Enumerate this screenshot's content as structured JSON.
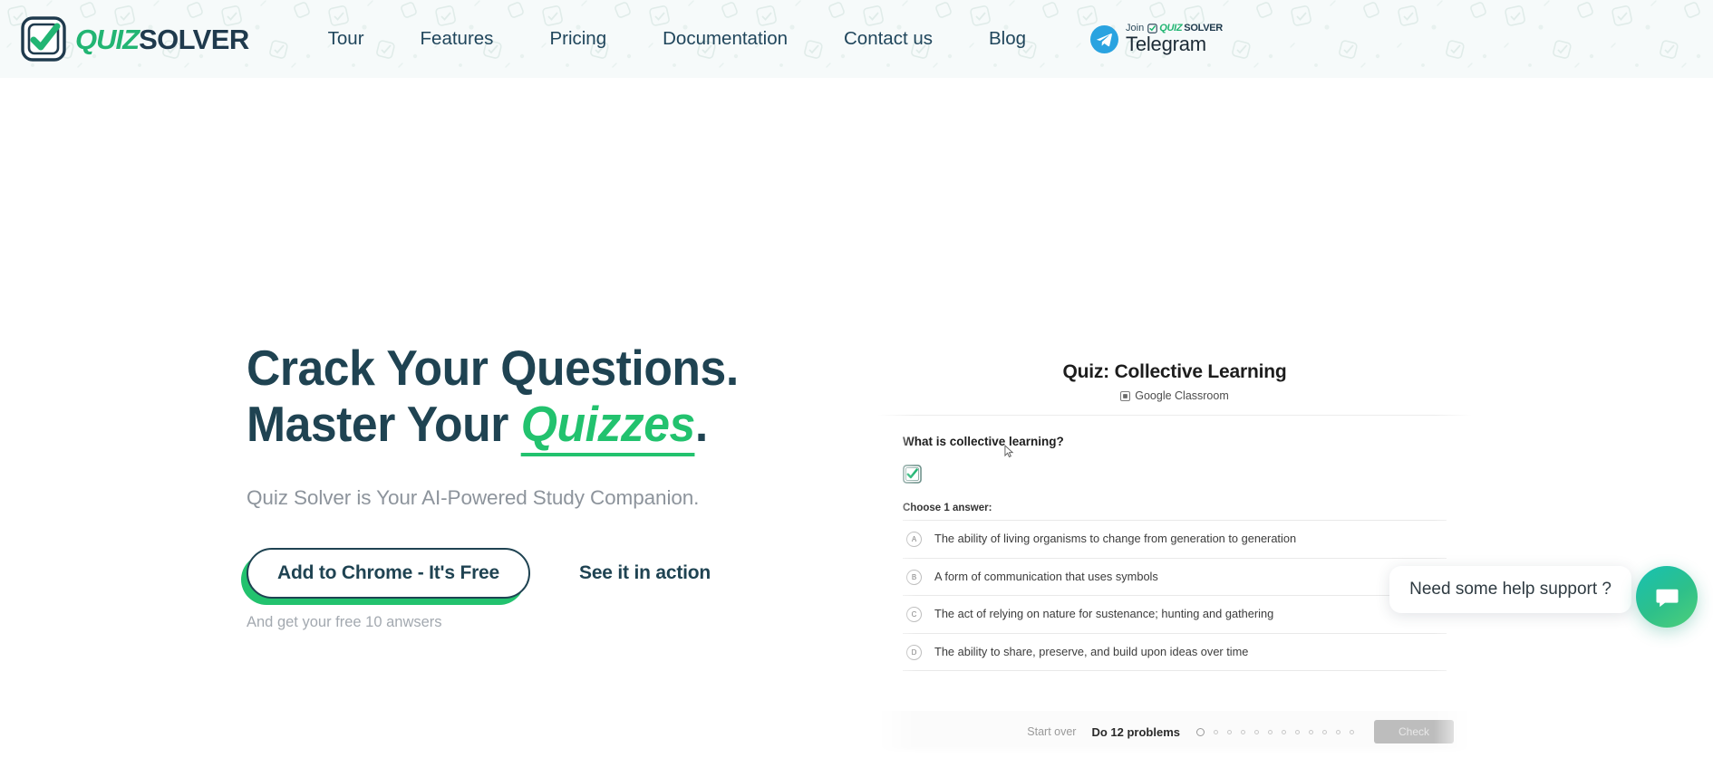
{
  "brand": {
    "logo_quiz": "QUIZ",
    "logo_solver": "SOLVER",
    "green": "#22b573",
    "navy": "#1f4352"
  },
  "nav": {
    "links": [
      {
        "label": "Tour"
      },
      {
        "label": "Features"
      },
      {
        "label": "Pricing"
      },
      {
        "label": "Documentation"
      },
      {
        "label": "Contact us"
      },
      {
        "label": "Blog"
      }
    ],
    "telegram": {
      "join_label": "Join",
      "chip_quiz": "QUIZ",
      "chip_solver": "SOLVER",
      "main_label": "Telegram"
    }
  },
  "hero": {
    "headline_line1": "Crack Your Questions.",
    "headline_line2_prefix": "Master Your ",
    "headline_highlight": "Quizzes",
    "headline_period": ".",
    "subheadline": "Quiz Solver is Your AI-Powered Study Companion.",
    "cta_primary": "Add to Chrome - It's Free",
    "cta_secondary": "See it in action",
    "cta_note": "And get your free 10 anwsers"
  },
  "quiz_preview": {
    "title": "Quiz: Collective Learning",
    "source": "Google Classroom",
    "question": "What is collective learning?",
    "choose_label": "Choose 1 answer:",
    "options": [
      {
        "letter": "A",
        "text": "The ability of living organisms to change from generation to generation"
      },
      {
        "letter": "B",
        "text": "A form of communication that uses symbols"
      },
      {
        "letter": "C",
        "text": "The act of relying on nature for sustenance; hunting and gathering"
      },
      {
        "letter": "D",
        "text": "The ability to share, preserve, and build upon ideas over time"
      }
    ],
    "footer": {
      "start_over": "Start over",
      "problems": "Do 12 problems",
      "dot_count": 12,
      "active_dot_index": 0,
      "check_label": "Check"
    }
  },
  "chat_widget": {
    "message": "Need some help support ?",
    "icon": "chat-bubble-icon",
    "gradient_start": "#16c1b3",
    "gradient_end": "#4fd07a"
  }
}
